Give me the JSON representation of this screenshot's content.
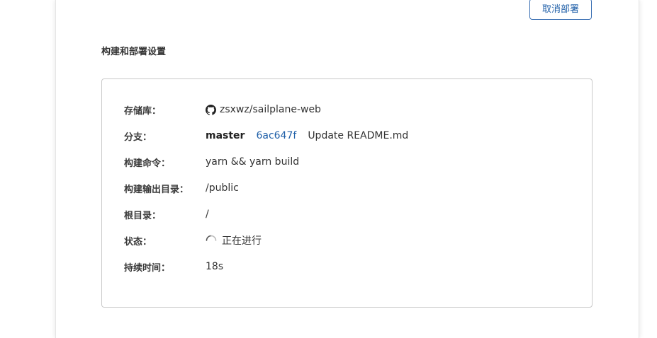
{
  "header": {
    "cancel_deploy_label": "取消部署"
  },
  "section": {
    "title": "构建和部署设置"
  },
  "settings": {
    "repository": {
      "label": "存储库：",
      "value": "zsxwz/sailplane-web",
      "icon": "github-icon"
    },
    "branch": {
      "label": "分支：",
      "name": "master",
      "commit_hash": "6ac647f",
      "commit_message": "Update README.md"
    },
    "build_command": {
      "label": "构建命令：",
      "value": "yarn && yarn build"
    },
    "output_dir": {
      "label": "构建输出目录：",
      "value": "/public"
    },
    "root_dir": {
      "label": "根目录：",
      "value": "/"
    },
    "status": {
      "label": "状态：",
      "value": "正在进行",
      "icon": "spinner-icon"
    },
    "duration": {
      "label": "持续时间：",
      "value": "18s"
    }
  },
  "colors": {
    "accent": "#1f5fa8",
    "border": "#c9c9c9",
    "text": "#333333"
  }
}
